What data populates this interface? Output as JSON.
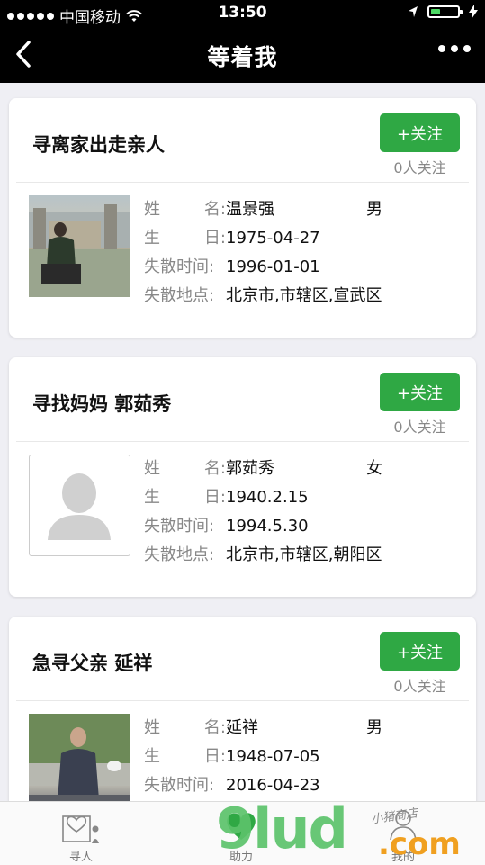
{
  "status_bar": {
    "carrier": "中国移动",
    "time": "13:50"
  },
  "nav": {
    "title": "等着我"
  },
  "cards": [
    {
      "title": "寻离家出走亲人",
      "follow_label": "+关注",
      "follow_count": "0人关注",
      "labels": {
        "name": "姓名:",
        "birth": "生日:",
        "lost_time": "失散时间:",
        "lost_place": "失散地点:"
      },
      "name": "温景强",
      "gender": "男",
      "birth": "1975-04-27",
      "lost_time": "1996-01-01",
      "lost_place": "北京市,市辖区,宣武区"
    },
    {
      "title": "寻找妈妈 郭茹秀",
      "follow_label": "+关注",
      "follow_count": "0人关注",
      "name": "郭茹秀",
      "gender": "女",
      "birth": "1940.2.15",
      "lost_time": "1994.5.30",
      "lost_place": "北京市,市辖区,朝阳区"
    },
    {
      "title": "急寻父亲 延祥",
      "follow_label": "+关注",
      "follow_count": "0人关注",
      "name": "延祥",
      "gender": "男",
      "birth": "1948-07-05",
      "lost_time": "2016-04-23"
    }
  ],
  "tabbar": {
    "items": [
      {
        "label": "寻人",
        "icon": "person-heart-icon"
      },
      {
        "label": "助力",
        "icon": "heart-icon"
      },
      {
        "label": "我的",
        "icon": "profile-icon"
      }
    ]
  },
  "watermark": {
    "text": "9lud",
    "domain": ".com",
    "tagline": "小猪商店"
  },
  "colors": {
    "accent": "#2fa844",
    "nav_bg": "#000000",
    "page_bg": "#efeff4"
  }
}
